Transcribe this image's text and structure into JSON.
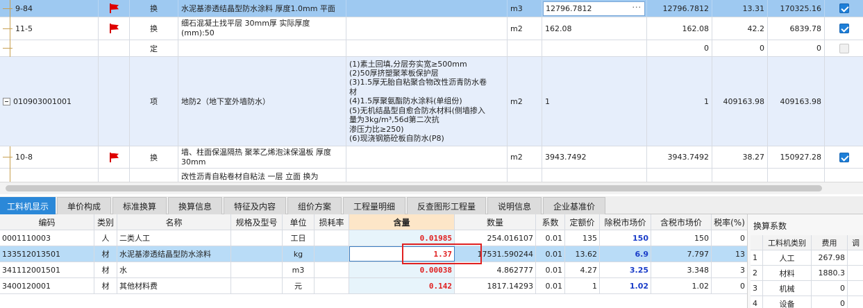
{
  "top_grid": {
    "rows": [
      {
        "code": "9-84",
        "type": "换",
        "name": "水泥基渗透结晶型防水涂料 厚度1.0mm 平面",
        "feature": "",
        "unit": "m3",
        "qty_expr": "12796.7812",
        "qty": "12796.7812",
        "price": "13.31",
        "total": "170325.16",
        "checked": true,
        "flag": true
      },
      {
        "code": "11-5",
        "type": "换",
        "name": "细石混凝土找平层 30mm厚  实际厚度(mm):50",
        "feature": "",
        "unit": "m2",
        "qty_expr": "162.08",
        "qty": "162.08",
        "price": "42.2",
        "total": "6839.78",
        "checked": true,
        "flag": true
      },
      {
        "code": "",
        "type": "定",
        "name": "",
        "feature": "",
        "unit": "",
        "qty_expr": "",
        "qty": "0",
        "price": "0",
        "total": "0",
        "checked": false,
        "flag": false
      },
      {
        "code": "010903001001",
        "type": "项",
        "name": "地防2（地下室外墙防水）",
        "feature_lines": [
          "(1)素土回填,分层夯实宽≥500mm",
          "(2)50厚挤塑聚苯板保护层",
          "(3)1.5厚无胎自粘聚合物改性沥青防水卷",
          "材",
          "(4)1.5厚聚氨酯防水涂料(单组份)",
          "(5)无机结晶型自愈合防水材料(侧墙掺入",
          "量为3kg/m³,56d第二次抗",
          "渗压力比≥250)",
          "(6)现浇钢筋砼板自防水(P8)"
        ],
        "unit": "m2",
        "qty_expr": "1",
        "qty": "1",
        "price": "409163.98",
        "total": "409163.98",
        "checked": false,
        "flag": false
      },
      {
        "code": "10-8",
        "type": "换",
        "name": "墙、柱面保温隔热 聚苯乙烯泡沫保温板 厚度30mm",
        "feature": "",
        "unit": "m2",
        "qty_expr": "3943.7492",
        "qty": "3943.7492",
        "price": "38.27",
        "total": "150927.28",
        "checked": true,
        "flag": true
      },
      {
        "code": "",
        "type": "",
        "name": "改性沥青自粘卷材自粘法 一层 立面  换为",
        "feature": "",
        "unit": "",
        "qty_expr": "",
        "qty": "",
        "price": "",
        "total": "",
        "checked": false,
        "flag": false
      }
    ],
    "edit_dots": "···"
  },
  "tabs": [
    {
      "label": "工料机显示",
      "active": true
    },
    {
      "label": "单价构成",
      "active": false
    },
    {
      "label": "标准换算",
      "active": false
    },
    {
      "label": "换算信息",
      "active": false
    },
    {
      "label": "特征及内容",
      "active": false
    },
    {
      "label": "组价方案",
      "active": false
    },
    {
      "label": "工程量明细",
      "active": false
    },
    {
      "label": "反查图形工程量",
      "active": false
    },
    {
      "label": "说明信息",
      "active": false
    },
    {
      "label": "企业基准价",
      "active": false
    }
  ],
  "bottom_grid": {
    "headers": [
      "编码",
      "类别",
      "名称",
      "规格及型号",
      "单位",
      "损耗率",
      "含量",
      "数量",
      "系数",
      "定额价",
      "除税市场价",
      "含税市场价",
      "税率(%)"
    ],
    "rows": [
      {
        "code": "0001110003",
        "cat": "人",
        "name": "二类人工",
        "spec": "",
        "unit": "工日",
        "loss": "",
        "content": "0.01985",
        "qty": "254.016107",
        "coef": "0.01",
        "quota": "135",
        "ex_tax": "150",
        "in_tax": "150",
        "tax": "0"
      },
      {
        "code": "133512013501",
        "cat": "材",
        "name": "水泥基渗透结晶型防水涂料",
        "spec": "",
        "unit": "kg",
        "loss": "",
        "content": "1.37",
        "qty": "17531.590244",
        "coef": "0.01",
        "quota": "13.62",
        "ex_tax": "6.9",
        "in_tax": "7.797",
        "tax": "13"
      },
      {
        "code": "341112001501",
        "cat": "材",
        "name": "水",
        "spec": "",
        "unit": "m3",
        "loss": "",
        "content": "0.00038",
        "qty": "4.862777",
        "coef": "0.01",
        "quota": "4.27",
        "ex_tax": "3.25",
        "in_tax": "3.348",
        "tax": "3"
      },
      {
        "code": "3400120001",
        "cat": "材",
        "name": "其他材料费",
        "spec": "",
        "unit": "元",
        "loss": "",
        "content": "0.142",
        "qty": "1817.14293",
        "coef": "0.01",
        "quota": "1",
        "ex_tax": "1.02",
        "in_tax": "1.02",
        "tax": "0"
      }
    ]
  },
  "right_panel": {
    "title": "换算系数",
    "headers": [
      "",
      "工料机类别",
      "费用",
      "调"
    ],
    "rows": [
      {
        "idx": "1",
        "cat": "人工",
        "fee": "267.98"
      },
      {
        "idx": "2",
        "cat": "材料",
        "fee": "1880.3"
      },
      {
        "idx": "3",
        "cat": "机械",
        "fee": "0"
      },
      {
        "idx": "4",
        "cat": "设备",
        "fee": "0"
      }
    ]
  }
}
